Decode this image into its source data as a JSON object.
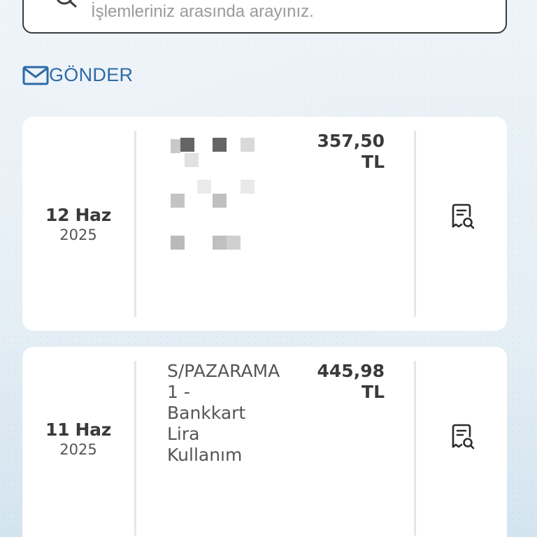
{
  "search": {
    "placeholder": "İşlemleriniz arasında arayınız."
  },
  "send": {
    "label": "GÖNDER",
    "icon": "mail-icon",
    "color": "#2e6aa6"
  },
  "transactions": [
    {
      "day": "12 Haz",
      "year": "2025",
      "description": "",
      "amount": "357,50\nTL",
      "icon": "receipt-search-icon"
    },
    {
      "day": "11 Haz",
      "year": "2025",
      "description": "S/PAZARAMA\n1 -\nBankkart\nLira\nKullanım",
      "amount": "445,98\nTL",
      "icon": "receipt-search-icon"
    }
  ]
}
